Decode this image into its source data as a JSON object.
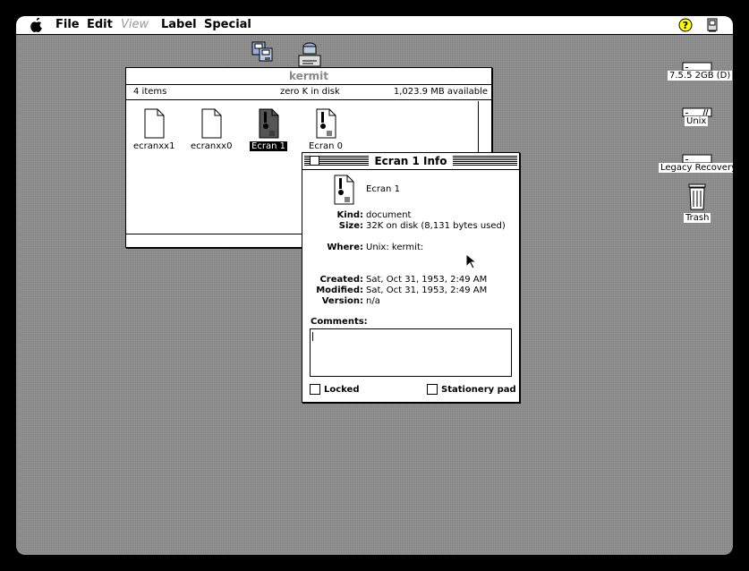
{
  "menubar": {
    "items": [
      "File",
      "Edit",
      "View",
      "Label",
      "Special"
    ]
  },
  "finder_window": {
    "title": "kermit",
    "item_count": "4 items",
    "disk_usage": "zero K in disk",
    "available": "1,023.9 MB available",
    "files": [
      {
        "name": "ecranxx1",
        "selected": false
      },
      {
        "name": "ecranxx0",
        "selected": false
      },
      {
        "name": "Ecran 1",
        "selected": true
      },
      {
        "name": "Ecran 0",
        "selected": false
      }
    ]
  },
  "info_window": {
    "title": "Ecran 1 Info",
    "file_name": "Ecran 1",
    "kind_label": "Kind:",
    "kind": "document",
    "size_label": "Size:",
    "size": "32K on disk (8,131 bytes used)",
    "where_label": "Where:",
    "where": "Unix: kermit:",
    "created_label": "Created:",
    "created": "Sat, Oct 31, 1953, 2:49 AM",
    "modified_label": "Modified:",
    "modified": "Sat, Oct 31, 1953, 2:49 AM",
    "version_label": "Version:",
    "version": "n/a",
    "comments_label": "Comments:",
    "locked_label": "Locked",
    "stationery_label": "Stationery pad"
  },
  "desktop": {
    "disk1": "7.5.5 2GB (D)",
    "disk2": "Unix",
    "disk3": "Legacy Recovery",
    "trash": "Trash"
  }
}
